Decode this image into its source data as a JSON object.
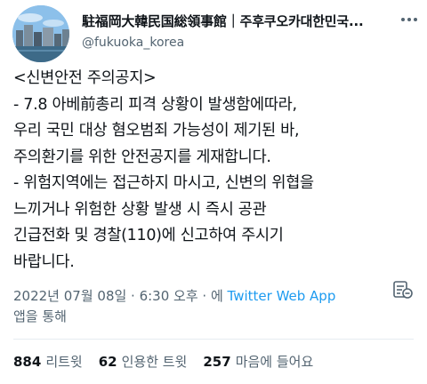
{
  "tweet": {
    "display_name": "駐福岡大韓民国総領事館｜주후쿠오카대한민국...",
    "handle": "@fukuoka_korea",
    "body_lines": [
      "<신변안전 주의공지>",
      "- 7.8 아베前총리 피격 상황이 발생함에따라,",
      "우리 국민 대상 혐오범죄 가능성이 제기된 바,",
      "주의환기를 위한 안전공지를 게재합니다.",
      "- 위험지역에는 접근하지 마시고, 신변의 위협을",
      "느끼거나 위험한 상황 발생 시 즉시 공관",
      "긴급전화 및 경찰(110)에 신고하여 주시기",
      "바랍니다."
    ],
    "timestamp": "2022년 07월 08일 · 6:30 오후 · 에",
    "source_app": "Twitter Web App",
    "source_suffix": "앱을 통해"
  },
  "stats": {
    "retweets_count": "884",
    "retweets_label": "리트윗",
    "quotes_count": "62",
    "quotes_label": "인용한 트윗",
    "likes_count": "257",
    "likes_label": "마음에 들어요"
  },
  "icons": {
    "more": "more-dots-icon",
    "translate": "translate-icon"
  },
  "colors": {
    "text": "#0f1419",
    "secondary": "#536471",
    "link": "#1d9bf0"
  }
}
